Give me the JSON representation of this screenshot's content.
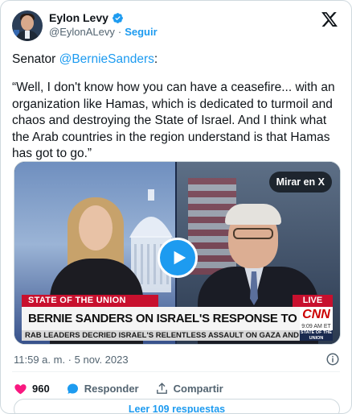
{
  "author": {
    "name": "Eylon Levy",
    "handle": "@EylonALevy",
    "separator": "·",
    "follow_label": "Seguir"
  },
  "tweet": {
    "lead": "Senator ",
    "mention": "@BernieSanders",
    "lead_end": ":",
    "quote": "“Well, I don't know how you can have a ceasefire... with an organization like Hamas, which is dedicated to turmoil and chaos and destroying the State of Israel. And I think what the Arab countries in the region understand is that Hamas has got to go.”"
  },
  "media": {
    "watch_label": "Mirar en X",
    "program_tag": "STATE OF THE UNION",
    "live_tag": "LIVE",
    "headline": "BERNIE SANDERS ON ISRAEL'S RESPONSE TO HAMAS ATTACKS",
    "network": "CNN",
    "clock": "9:09 AM ET",
    "ticker": "RAB LEADERS DECRIED ISRAEL'S RELENTLESS ASSAULT ON GAZA AND CALLED FOR AN",
    "ticker_logo": "STATE OF THE UNION"
  },
  "meta": {
    "timestamp": "11:59 a. m. · 5 nov. 2023"
  },
  "actions": {
    "likes": "960",
    "reply_label": "Responder",
    "share_label": "Compartir"
  },
  "read_replies_label": "Leer 109 respuestas",
  "colors": {
    "accent": "#1d9bf0",
    "like": "#f91880",
    "cnn_red": "#cc0000"
  }
}
